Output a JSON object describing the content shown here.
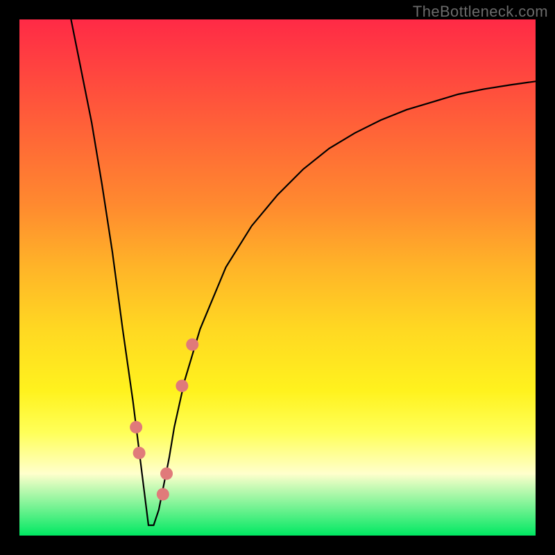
{
  "watermark": "TheBottleneck.com",
  "colors": {
    "background": "#000000",
    "gradient_top": "#ff2a46",
    "gradient_bottom": "#00e862",
    "curve": "#000000",
    "markers": "#e07a7a"
  },
  "chart_data": {
    "type": "line",
    "title": "",
    "xlabel": "",
    "ylabel": "",
    "xlim": [
      0,
      100
    ],
    "ylim": [
      0,
      100
    ],
    "description": "Bottleneck percentage curve (V-shape) against a vertical red-to-green gradient. Minimum bottleneck near x≈25. Left branch descends steeply from ≈100 at x=10 to ≈2 at x≈25; right branch rises with a concave (diminishing) slope to ≈88 at x=100.",
    "series": [
      {
        "name": "bottleneck-curve",
        "x": [
          10,
          12,
          14,
          16,
          18,
          20,
          21,
          22,
          23,
          24,
          25,
          26,
          27,
          28,
          29,
          30,
          32,
          35,
          40,
          45,
          50,
          55,
          60,
          65,
          70,
          75,
          80,
          85,
          90,
          95,
          100
        ],
        "y": [
          100,
          90,
          80,
          68,
          55,
          40,
          33,
          26,
          18,
          10,
          2,
          2,
          5,
          10,
          15,
          21,
          30,
          40,
          52,
          60,
          66,
          71,
          75,
          78,
          80.5,
          82.5,
          84,
          85.5,
          86.5,
          87.3,
          88
        ]
      }
    ],
    "markers": [
      {
        "type": "pill",
        "x1": 19.8,
        "y1": 41,
        "x2": 20.8,
        "y2": 34
      },
      {
        "type": "pill",
        "x1": 21.0,
        "y1": 33,
        "x2": 21.6,
        "y2": 28
      },
      {
        "type": "circle",
        "x": 22.6,
        "y": 21
      },
      {
        "type": "circle",
        "x": 23.2,
        "y": 16
      },
      {
        "type": "pill",
        "x1": 23.5,
        "y1": 14,
        "x2": 24.3,
        "y2": 8
      },
      {
        "type": "pill",
        "x1": 24.5,
        "y1": 6,
        "x2": 25.2,
        "y2": 2
      },
      {
        "type": "pill",
        "x1": 25.2,
        "y1": 2,
        "x2": 26.4,
        "y2": 2
      },
      {
        "type": "pill",
        "x1": 26.5,
        "y1": 2,
        "x2": 27.4,
        "y2": 5
      },
      {
        "type": "circle",
        "x": 27.8,
        "y": 8
      },
      {
        "type": "circle",
        "x": 28.5,
        "y": 12
      },
      {
        "type": "pill",
        "x1": 28.8,
        "y1": 14,
        "x2": 29.8,
        "y2": 20
      },
      {
        "type": "pill",
        "x1": 30.0,
        "y1": 21,
        "x2": 31.2,
        "y2": 27
      },
      {
        "type": "circle",
        "x": 31.5,
        "y": 29
      },
      {
        "type": "circle",
        "x": 33.5,
        "y": 37
      }
    ]
  }
}
